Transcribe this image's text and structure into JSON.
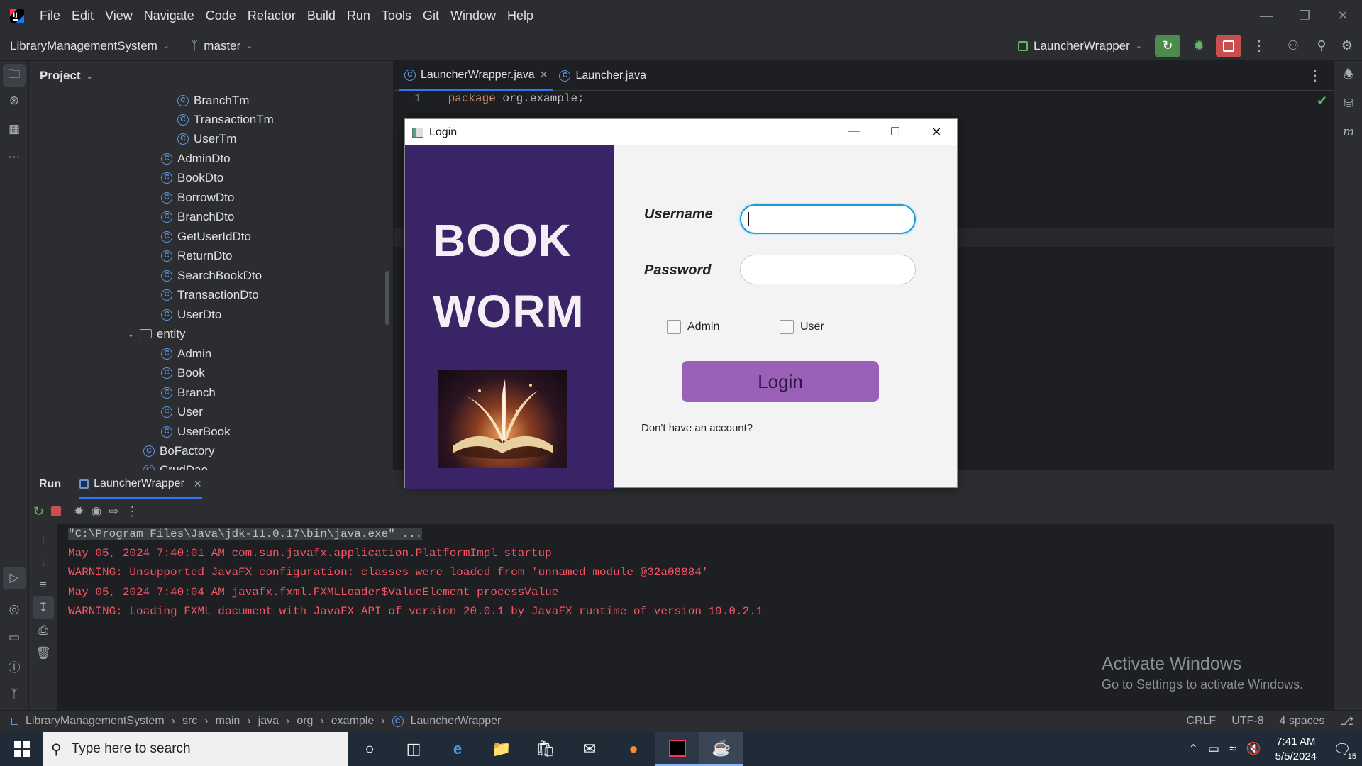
{
  "menu": [
    "File",
    "Edit",
    "View",
    "Navigate",
    "Code",
    "Refactor",
    "Build",
    "Run",
    "Tools",
    "Git",
    "Window",
    "Help"
  ],
  "toolbar": {
    "project_name": "LibraryManagementSystem",
    "branch": "master",
    "run_config": "LauncherWrapper"
  },
  "project_pane": {
    "title": "Project",
    "items": [
      "BranchTm",
      "TransactionTm",
      "UserTm",
      "AdminDto",
      "BookDto",
      "BorrowDto",
      "BranchDto",
      "GetUserIdDto",
      "ReturnDto",
      "SearchBookDto",
      "TransactionDto",
      "UserDto",
      "entity",
      "Admin",
      "Book",
      "Branch",
      "User",
      "UserBook",
      "BoFactory",
      "CrudDao"
    ]
  },
  "editor": {
    "tabs": [
      {
        "label": "LauncherWrapper.java",
        "closable": true
      },
      {
        "label": "Launcher.java",
        "closable": false
      }
    ],
    "line_number": "1",
    "code": "package org.example;"
  },
  "login": {
    "window_title": "Login",
    "brand_line1": "BOOK",
    "brand_line2": "WORM",
    "username_label": "Username",
    "password_label": "Password",
    "admin_label": "Admin",
    "user_label": "User",
    "login_button": "Login",
    "signup_text": "Don't have an account?"
  },
  "run_panel": {
    "tab_run": "Run",
    "tab_config": "LauncherWrapper",
    "console": [
      "\"C:\\Program Files\\Java\\jdk-11.0.17\\bin\\java.exe\" ...",
      "May 05, 2024 7:40:01 AM com.sun.javafx.application.PlatformImpl startup",
      "WARNING: Unsupported JavaFX configuration: classes were loaded from 'unnamed module @32a08884'",
      "May 05, 2024 7:40:04 AM javafx.fxml.FXMLLoader$ValueElement processValue",
      "WARNING: Loading FXML document with JavaFX API of version 20.0.1 by JavaFX runtime of version 19.0.2.1"
    ]
  },
  "watermark": {
    "line1": "Activate Windows",
    "line2": "Go to Settings to activate Windows."
  },
  "statusbar": {
    "breadcrumb": [
      "LibraryManagementSystem",
      "src",
      "main",
      "java",
      "org",
      "example",
      "LauncherWrapper"
    ],
    "line_sep": "CRLF",
    "encoding": "UTF-8",
    "indent": "4 spaces"
  },
  "taskbar": {
    "search_placeholder": "Type here to search",
    "time": "7:41 AM",
    "date": "5/5/2024",
    "notifications": "15"
  },
  "colors": {
    "accent": "#3574f0",
    "brand_purple": "#3a2367",
    "login_button": "#9b60b8",
    "console_red": "#f75464"
  }
}
